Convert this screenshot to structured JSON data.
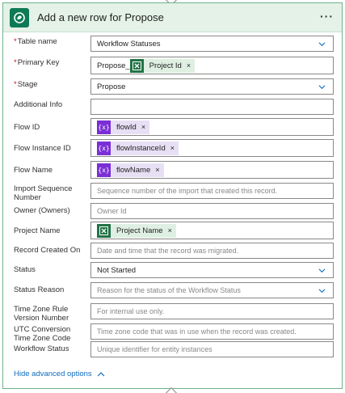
{
  "header": {
    "title": "Add a new row for Propose",
    "menu_label": "···"
  },
  "fields": {
    "table_name": {
      "label": "Table name",
      "value": "Workflow Statuses"
    },
    "primary_key": {
      "label": "Primary Key",
      "prefix": "Propose_",
      "token": "Project Id"
    },
    "stage": {
      "label": "Stage",
      "value": "Propose"
    },
    "additional_info": {
      "label": "Additional Info",
      "value": ""
    },
    "flow_id": {
      "label": "Flow ID",
      "token": "flowId"
    },
    "flow_instance_id": {
      "label": "Flow Instance ID",
      "token": "flowInstanceId"
    },
    "flow_name": {
      "label": "Flow Name",
      "token": "flowName"
    },
    "import_sequence_number": {
      "label": "Import Sequence Number",
      "placeholder": "Sequence number of the import that created this record."
    },
    "owner": {
      "label": "Owner (Owners)",
      "placeholder": "Owner Id"
    },
    "project_name": {
      "label": "Project Name",
      "token": "Project Name"
    },
    "record_created_on": {
      "label": "Record Created On",
      "placeholder": "Date and time that the record was migrated."
    },
    "status": {
      "label": "Status",
      "value": "Not Started"
    },
    "status_reason": {
      "label": "Status Reason",
      "placeholder": "Reason for the status of the Workflow Status"
    },
    "time_zone_rule_version_number": {
      "label": "Time Zone Rule Version Number",
      "placeholder": "For internal use only."
    },
    "utc_conversion_time_zone_code": {
      "label": "UTC Conversion Time Zone Code",
      "placeholder": "Time zone code that was in use when the record was created."
    },
    "workflow_status": {
      "label": "Workflow Status",
      "placeholder": "Unique identifier for entity instances"
    }
  },
  "required_marker": "*",
  "token_remove": "×",
  "expression_icon_text": "{x}",
  "advanced": {
    "label": "Hide advanced options"
  },
  "colors": {
    "accent_green": "#0e7a55",
    "header_bg": "#e4f2e8",
    "expression_purple": "#7a2fd6",
    "excel_green": "#217346",
    "link_blue": "#0f6cbd",
    "required_red": "#c50f1f"
  },
  "icons": {
    "header": "dataverse-icon",
    "dropdown": "chevron-down-icon",
    "dynamic_content": "excel-icon",
    "expression": "expression-icon",
    "advanced": "chevron-up-icon"
  }
}
